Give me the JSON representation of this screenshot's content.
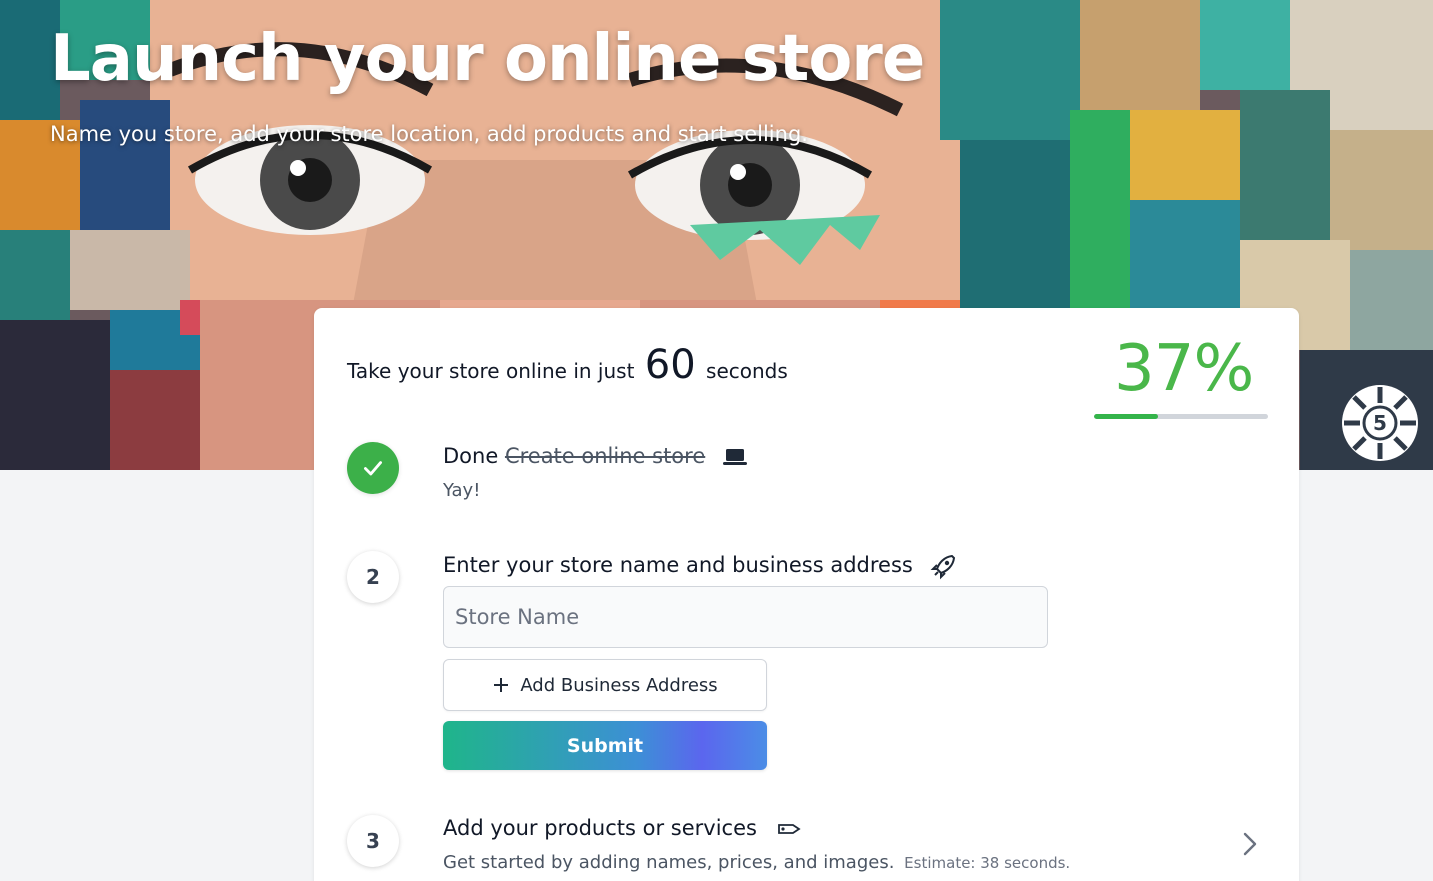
{
  "hero": {
    "title": "Launch your online store",
    "subtitle": "Name you store, add your store location, add products and start selling."
  },
  "card": {
    "headline_prefix": "Take your store online in just",
    "headline_number": "60",
    "headline_suffix": "seconds",
    "progress_label": "37%",
    "progress_value": 0.37
  },
  "steps": [
    {
      "status": "done",
      "status_label": "Done",
      "title": "Create online store",
      "icon": "laptop-icon",
      "subtitle": "Yay!"
    },
    {
      "number": "2",
      "title": "Enter your store name and business address",
      "icon": "rocket-icon",
      "store_name_placeholder": "Store Name",
      "store_name_value": "",
      "add_address_label": "Add Business Address",
      "submit_label": "Submit"
    },
    {
      "number": "3",
      "title": "Add your products or services",
      "icon": "tag-icon",
      "subtitle": "Get started by adding names, prices, and images.",
      "estimate": "Estimate: 38 seconds."
    }
  ],
  "colors": {
    "accent_green": "#3cb049",
    "progress_track": "#d1d5db",
    "submit_gradient_start": "#1fb58a",
    "submit_gradient_end": "#5b66ee"
  }
}
